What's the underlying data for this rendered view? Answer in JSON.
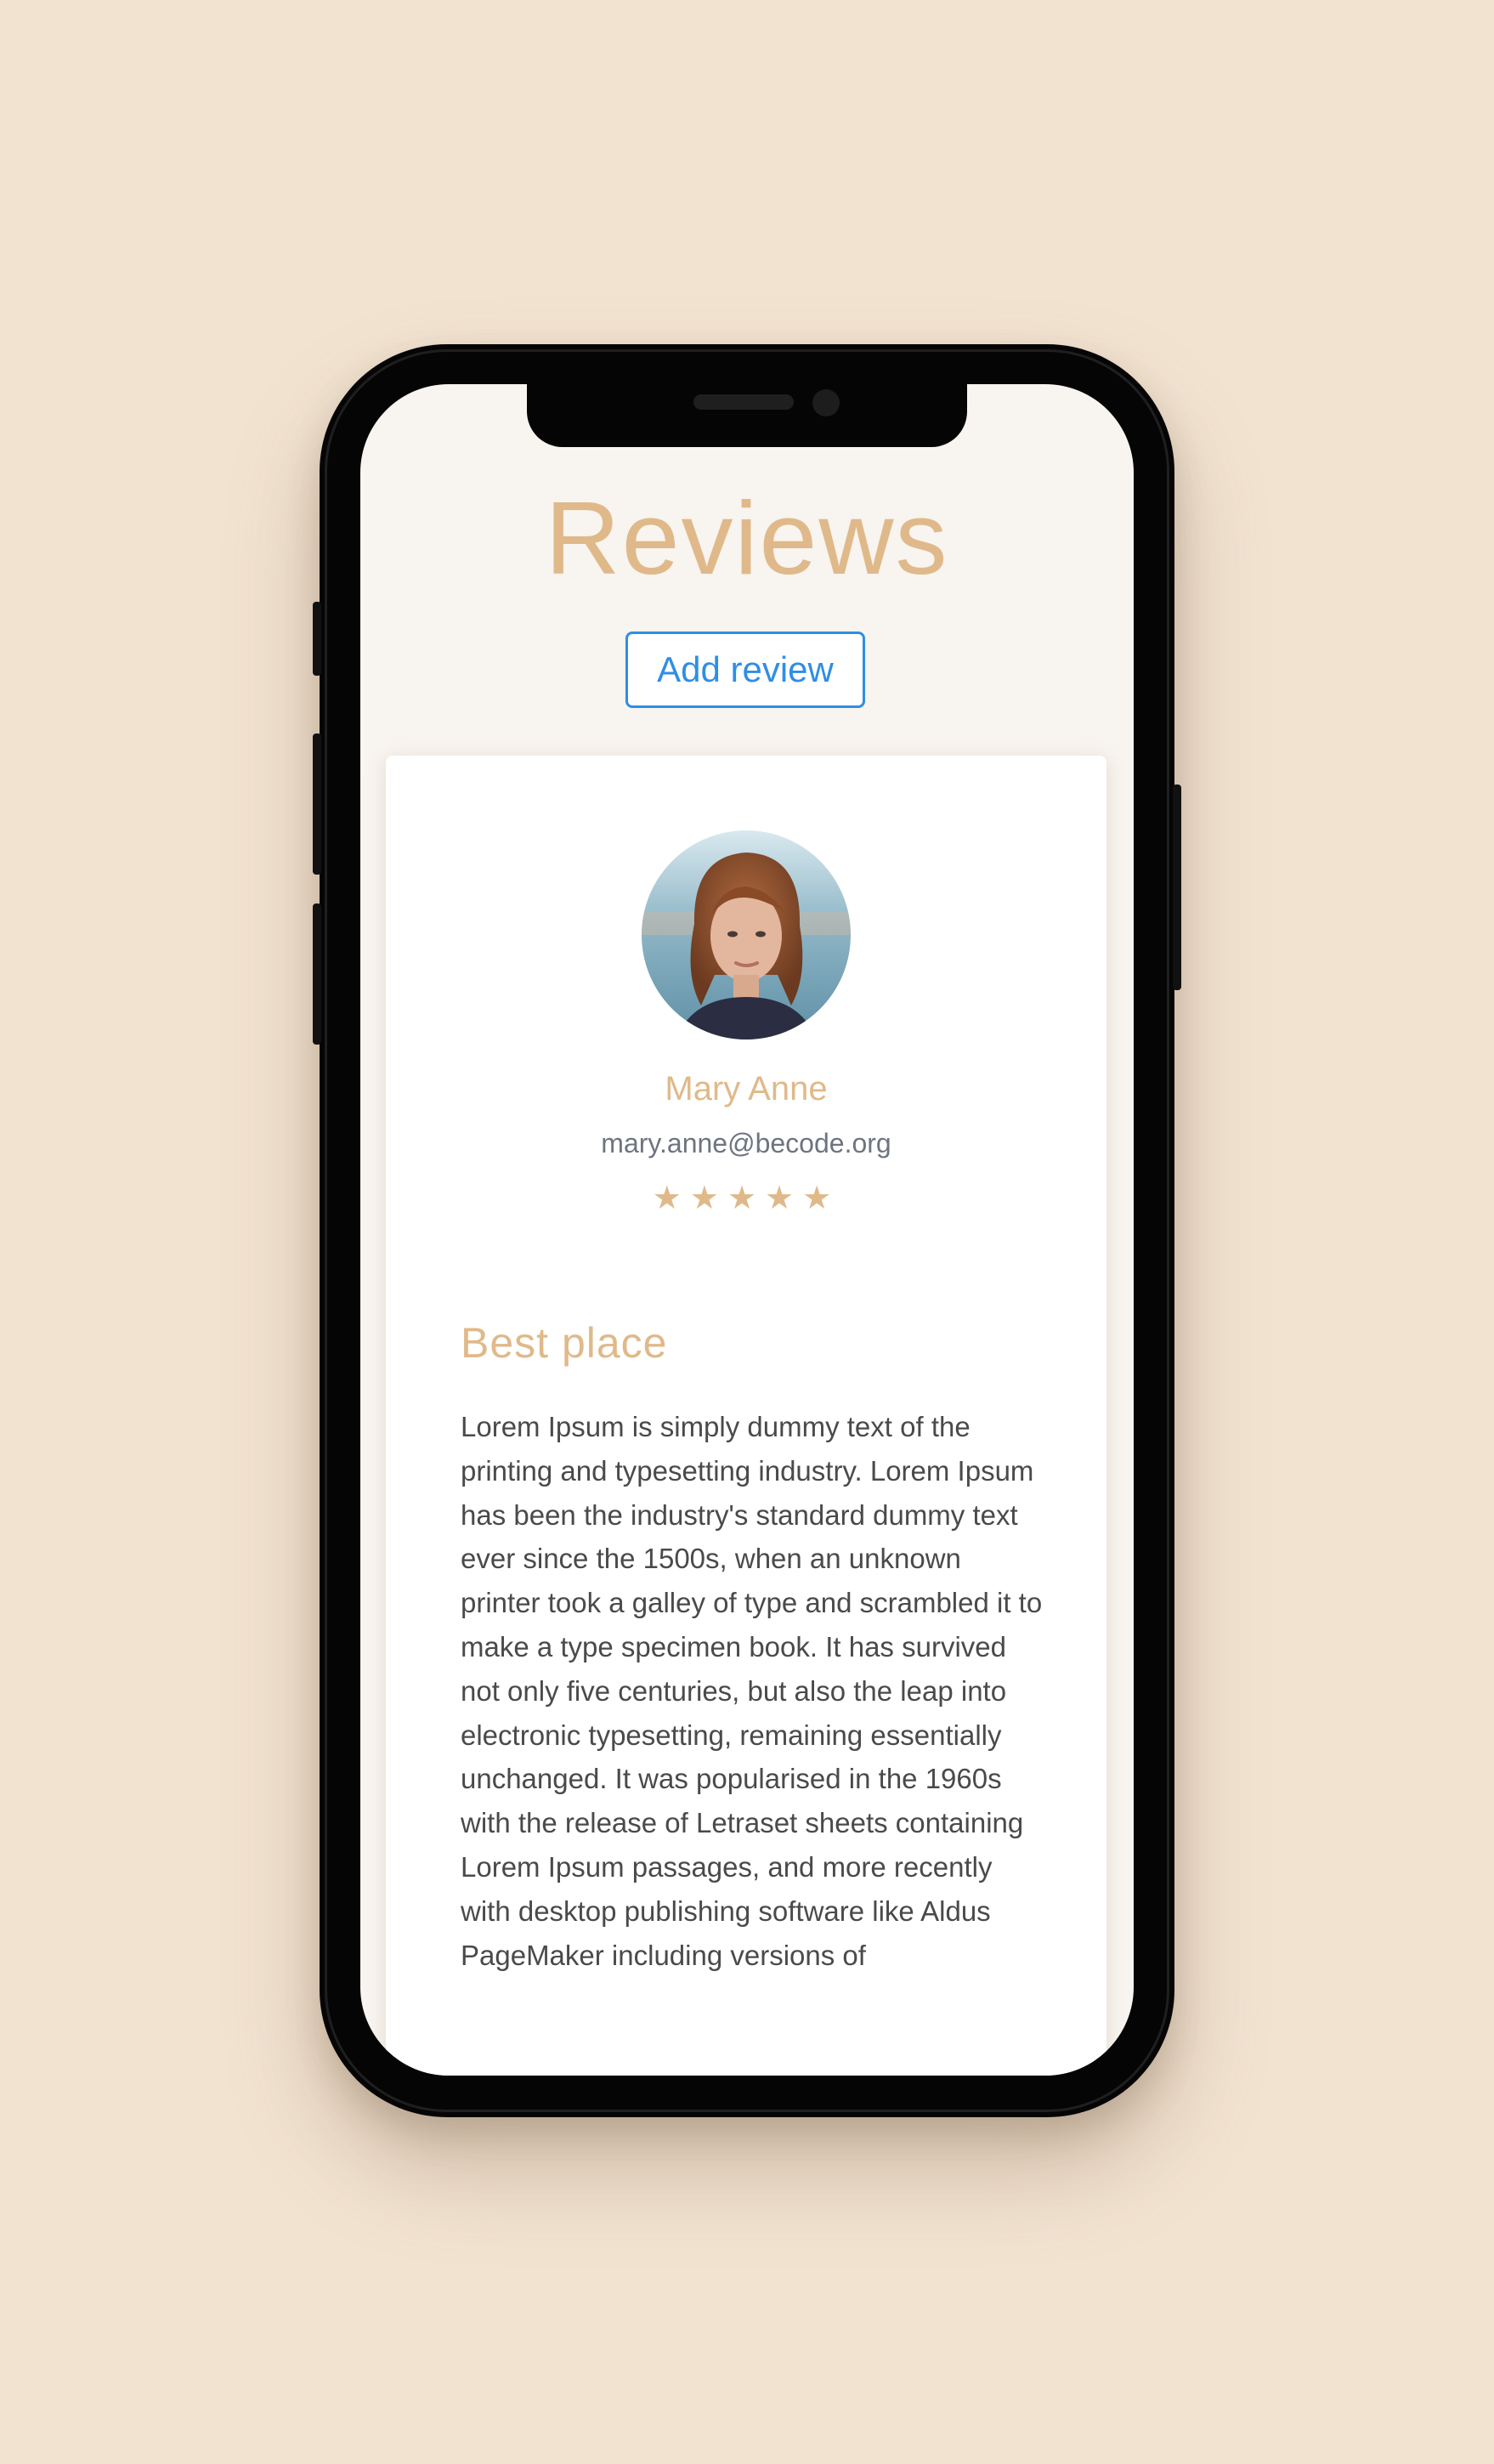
{
  "page": {
    "title": "Reviews",
    "add_review_label": "Add review"
  },
  "review": {
    "avatar_icon": "user-photo-avatar",
    "author_name": "Mary Anne",
    "author_email": "mary.anne@becode.org",
    "rating": 5,
    "rating_max": 5,
    "star_glyph": "★",
    "title": "Best place",
    "body": "Lorem Ipsum is simply dummy text of the printing and typesetting industry. Lorem Ipsum has been the industry's standard dummy text ever since the 1500s, when an unknown printer took a galley of type and scrambled it to make a type specimen book. It has survived not only five centuries, but also the leap into electronic typesetting, remaining essentially unchanged. It was popularised in the 1960s with the release of Letraset sheets containing Lorem Ipsum passages, and more recently with desktop publishing software like Aldus PageMaker including versions of"
  },
  "colors": {
    "background": "#f2e3d1",
    "accent_gold": "#e0b98a",
    "button_blue": "#2f8ee5",
    "email_gray": "#6e7480",
    "body_text": "#4a4a4a"
  }
}
